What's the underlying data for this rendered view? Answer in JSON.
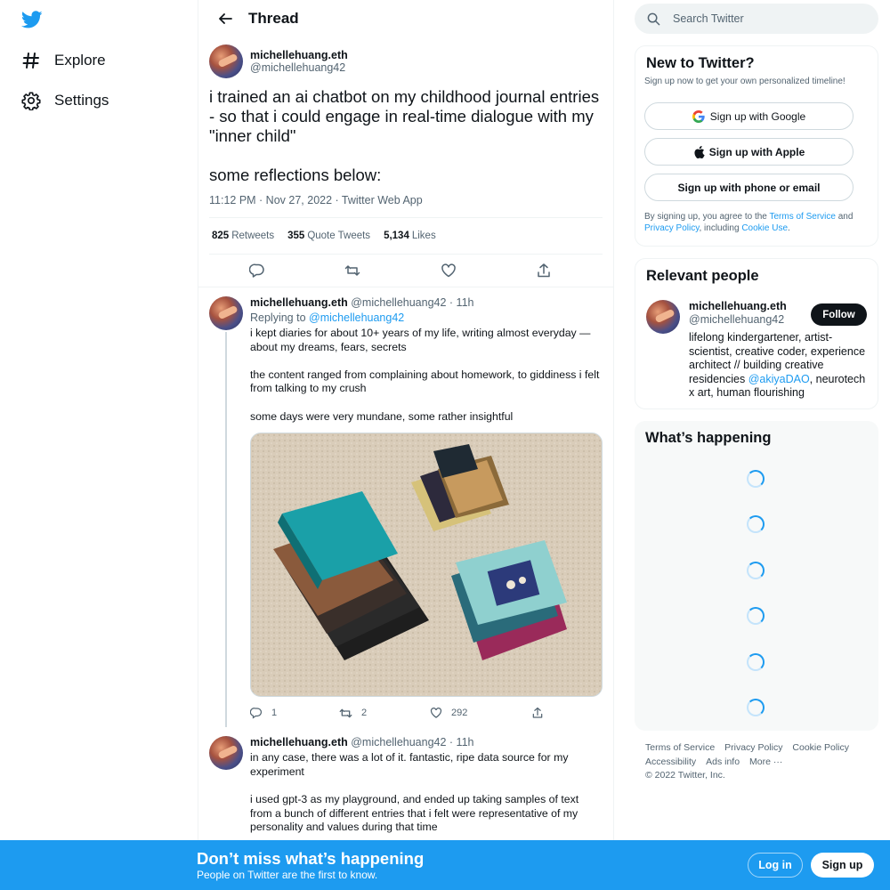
{
  "nav": {
    "items": [
      {
        "label": "Explore",
        "icon": "hashtag-icon"
      },
      {
        "label": "Settings",
        "icon": "gear-icon"
      }
    ]
  },
  "header": {
    "title": "Thread"
  },
  "main_tweet": {
    "name": "michellehuang.eth",
    "handle": "@michellehuang42",
    "text": "i trained an ai chatbot on my childhood journal entries - so that i could engage in real-time dialogue with my \"inner child\"\n\nsome reflections below:",
    "meta": "11:12 PM · Nov 27, 2022 · Twitter Web App",
    "stats": {
      "retweets": "825",
      "retweets_label": "Retweets",
      "quotes": "355",
      "quotes_label": "Quote Tweets",
      "likes": "5,134",
      "likes_label": "Likes"
    }
  },
  "replies": [
    {
      "name": "michellehuang.eth",
      "handle_time": "@michellehuang42 · 11h",
      "replying_prefix": "Replying to",
      "replying_to": "@michellehuang42",
      "text": "i kept diaries for about 10+ years of my life, writing almost everyday — about my dreams, fears, secrets\n\nthe content ranged from complaining about homework, to giddiness i felt from talking to my crush\n\nsome days were very mundane, some rather insightful",
      "counts": {
        "replies": "1",
        "retweets": "2",
        "likes": "292"
      }
    },
    {
      "name": "michellehuang.eth",
      "handle_time": "@michellehuang42 · 11h",
      "text": "in any case, there was a lot of it. fantastic, ripe data source for my experiment\n\ni used gpt-3 as my playground, and ended up taking samples of text from a bunch of different entries that i felt were representative of my personality and values during that time"
    }
  ],
  "search": {
    "placeholder": "Search Twitter"
  },
  "new_to_twitter": {
    "title": "New to Twitter?",
    "subtitle": "Sign up now to get your own personalized timeline!",
    "google": "Sign up with Google",
    "apple": "Sign up with Apple",
    "phone": "Sign up with phone or email",
    "terms_prefix": "By signing up, you agree to the",
    "terms_link": "Terms of Service",
    "terms_and": "and",
    "privacy_link": "Privacy Policy",
    "terms_including": ", including",
    "cookie_link": "Cookie Use",
    "terms_end": "."
  },
  "relevant": {
    "title": "Relevant people",
    "name": "michellehuang.eth",
    "handle": "@michellehuang42",
    "follow": "Follow",
    "bio_pre": "lifelong kindergartener, artist-scientist, creative coder, experience architect // building creative residencies ",
    "bio_link": "@akiyaDAO",
    "bio_post": ", neurotech x art, human flourishing"
  },
  "happening": {
    "title": "What’s happening"
  },
  "footer": {
    "links": [
      "Terms of Service",
      "Privacy Policy",
      "Cookie Policy",
      "Accessibility",
      "Ads info",
      "More ···"
    ],
    "copyright": "© 2022 Twitter, Inc."
  },
  "banner": {
    "title": "Don’t miss what’s happening",
    "subtitle": "People on Twitter are the first to know.",
    "login": "Log in",
    "signup": "Sign up"
  },
  "colors": {
    "brand": "#1d9bf0",
    "text": "#0f1419",
    "secondary": "#536471"
  }
}
